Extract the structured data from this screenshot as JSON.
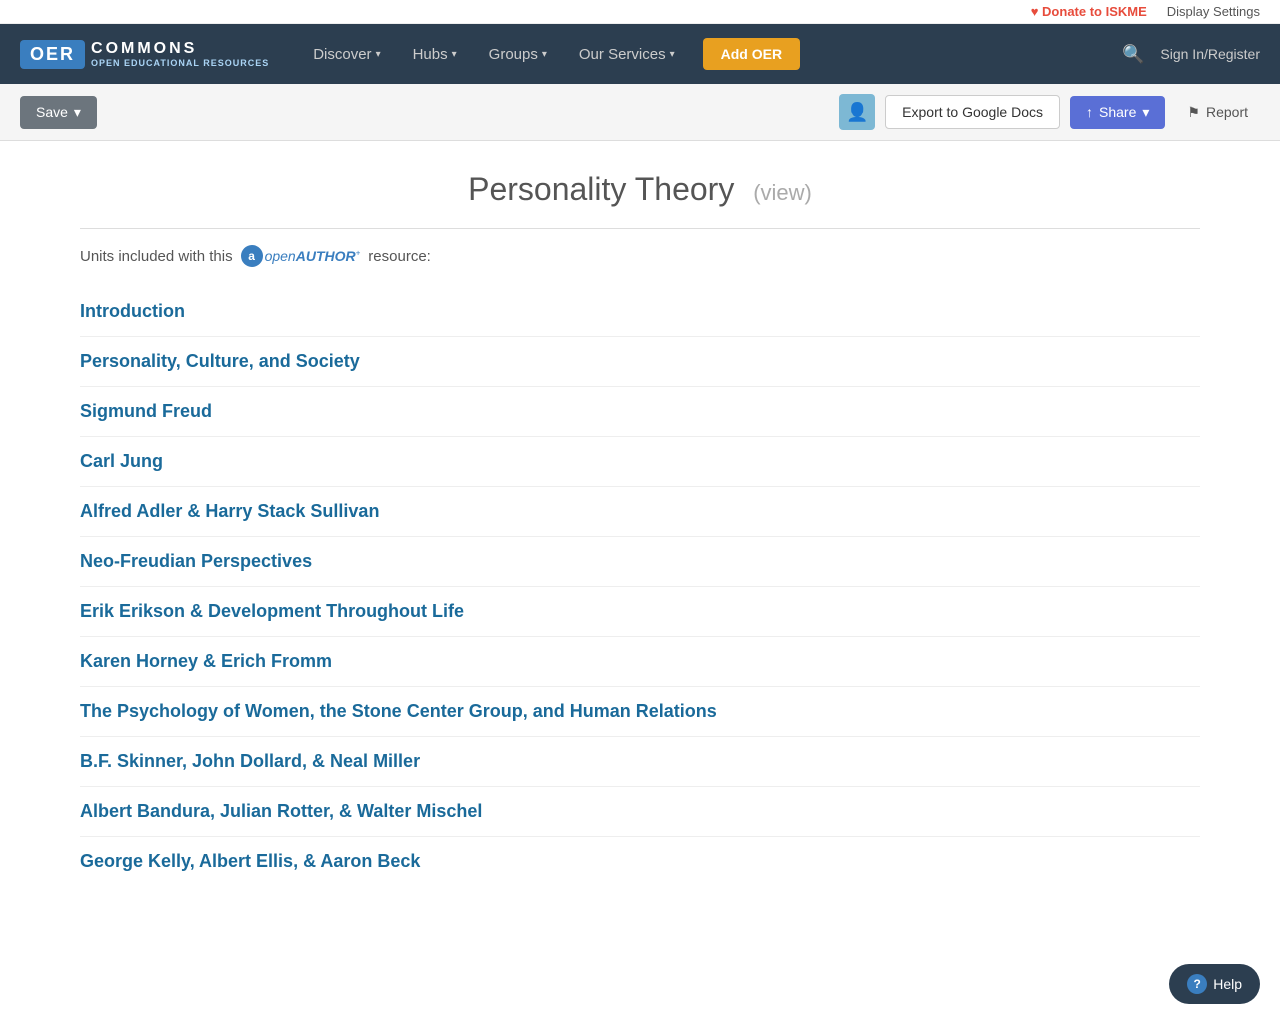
{
  "topbar": {
    "donate_label": "Donate to ISKME",
    "display_settings_label": "Display Settings"
  },
  "navbar": {
    "logo_text": "OER",
    "logo_name": "COMMONS",
    "logo_sub": "OPEN EDUCATIONAL RESOURCES",
    "nav_items": [
      {
        "label": "Discover",
        "has_dropdown": true
      },
      {
        "label": "Hubs",
        "has_dropdown": true
      },
      {
        "label": "Groups",
        "has_dropdown": true
      },
      {
        "label": "Our Services",
        "has_dropdown": true
      }
    ],
    "add_oer_label": "Add OER",
    "signin_label": "Sign In/Register"
  },
  "actionbar": {
    "save_label": "Save",
    "export_label": "Export to Google Docs",
    "share_label": "Share",
    "report_label": "Report"
  },
  "page": {
    "title": "Personality Theory",
    "view_label": "(view)",
    "units_intro_prefix": "Units included with this",
    "units_intro_suffix": "resource:",
    "units": [
      {
        "label": "Introduction"
      },
      {
        "label": "Personality, Culture, and Society"
      },
      {
        "label": "Sigmund Freud"
      },
      {
        "label": "Carl Jung"
      },
      {
        "label": "Alfred Adler & Harry Stack Sullivan"
      },
      {
        "label": "Neo-Freudian Perspectives"
      },
      {
        "label": "Erik Erikson & Development Throughout Life"
      },
      {
        "label": "Karen Horney & Erich Fromm"
      },
      {
        "label": "The Psychology of Women, the Stone Center Group, and Human Relations"
      },
      {
        "label": "B.F. Skinner, John Dollard, & Neal Miller"
      },
      {
        "label": "Albert Bandura, Julian Rotter, & Walter Mischel"
      },
      {
        "label": "George Kelly, Albert Ellis, & Aaron Beck"
      }
    ]
  },
  "help": {
    "label": "Help"
  }
}
